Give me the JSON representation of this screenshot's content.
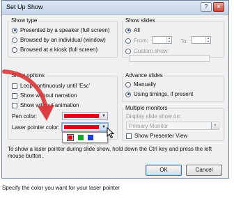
{
  "window": {
    "title": "Set Up Show",
    "help_glyph": "?",
    "close_glyph": "×"
  },
  "show_type": {
    "label": "Show type",
    "options": [
      {
        "label": "Presented by a speaker (full screen)",
        "selected": true
      },
      {
        "label": "Browsed by an individual (window)",
        "selected": false
      },
      {
        "label": "Browsed at a kiosk (full screen)",
        "selected": false
      }
    ]
  },
  "show_slides": {
    "label": "Show slides",
    "all_label": "All",
    "from_label": "From:",
    "to_label": "To:",
    "from_value": "",
    "to_value": "",
    "custom_label": "Custom show:",
    "custom_value": ""
  },
  "show_options": {
    "label": "Show options",
    "loop_label": "Loop continuously until 'Esc'",
    "narration_label": "Show without narration",
    "animation_label": "Show without animation",
    "pen_label": "Pen color:",
    "laser_label": "Laser pointer color:",
    "pen_color": "#e2001a",
    "laser_color": "#e2001a",
    "palette": [
      "#e2001a",
      "#17a52c",
      "#1e3fcf"
    ]
  },
  "advance_slides": {
    "label": "Advance slides",
    "manual_label": "Manually",
    "timings_label": "Using timings, if present"
  },
  "multiple_monitors": {
    "label": "Multiple monitors",
    "display_label": "Display slide show on:",
    "display_value": "Primary Monitor",
    "presenter_label": "Show Presenter View"
  },
  "hint": "To show a laser pointer during slide show, hold down the Ctrl key and press the left mouse button.",
  "buttons": {
    "ok": "OK",
    "cancel": "Cancel"
  },
  "caption": "Specify the color you want for your laser pointer",
  "colors": {
    "arrow": "#d9373a",
    "accent": "#1a3f8f"
  }
}
